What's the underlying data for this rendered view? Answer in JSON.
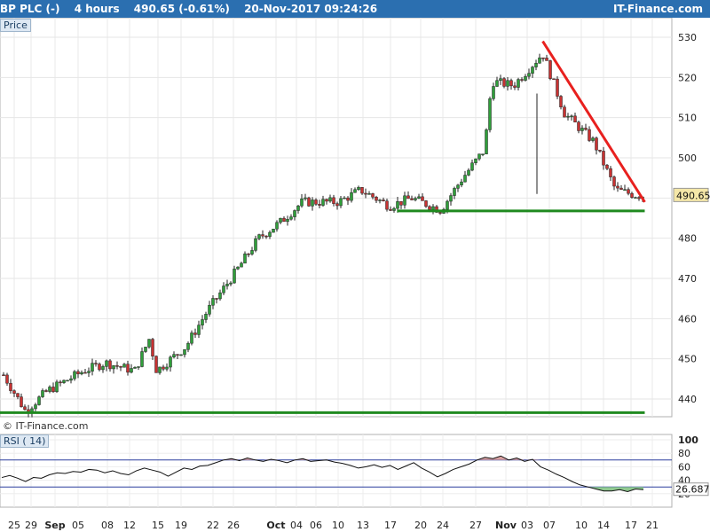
{
  "header": {
    "symbol": "BP PLC (-)",
    "timeframe": "4 hours",
    "quote": "490.65 (-0.61%)",
    "datetime": "20-Nov-2017 09:24:26",
    "brand": "IT-Finance.com"
  },
  "price_chip": "Price",
  "rsi_chip": "RSI ( 14)",
  "watermark": "© IT-Finance.com",
  "colors": {
    "header_bg": "#2b6fb0",
    "bull": "#2f9e3a",
    "bear": "#c83232",
    "resistance": "#e8201e",
    "support": "#1f8a1f",
    "rsi_band": "#2b3f9e",
    "rsi_over": "#d9a1a1",
    "rsi_under": "#8fc98f",
    "last_price_bg": "#f5e7a8"
  },
  "chart_data": [
    {
      "type": "candlestick",
      "ylim": [
        434,
        533
      ],
      "y_ticks": [
        440,
        450,
        460,
        470,
        480,
        490,
        500,
        510,
        520,
        530
      ],
      "last_price_label": "490.65",
      "x_tick_labels": [
        "25",
        "29",
        "Sep",
        "05",
        "08",
        "12",
        "15",
        "19",
        "22",
        "26",
        "Oct",
        "04",
        "06",
        "10",
        "13",
        "17",
        "20",
        "24",
        "27",
        "Nov",
        "03",
        "07",
        "10",
        "14",
        "17",
        "21"
      ],
      "key_points": [
        {
          "date": "2017-08-25",
          "price": 446
        },
        {
          "date": "2017-08-28",
          "price": 437
        },
        {
          "date": "2017-08-31",
          "price": 442
        },
        {
          "date": "2017-09-05",
          "price": 447
        },
        {
          "date": "2017-09-08",
          "price": 449
        },
        {
          "date": "2017-09-12",
          "price": 447
        },
        {
          "date": "2017-09-14",
          "price": 455
        },
        {
          "date": "2017-09-15",
          "price": 447
        },
        {
          "date": "2017-09-19",
          "price": 453
        },
        {
          "date": "2017-09-22",
          "price": 462
        },
        {
          "date": "2017-09-26",
          "price": 472
        },
        {
          "date": "2017-09-29",
          "price": 480
        },
        {
          "date": "2017-10-02",
          "price": 484
        },
        {
          "date": "2017-10-05",
          "price": 489
        },
        {
          "date": "2017-10-10",
          "price": 489
        },
        {
          "date": "2017-10-13",
          "price": 492
        },
        {
          "date": "2017-10-17",
          "price": 488
        },
        {
          "date": "2017-10-20",
          "price": 490
        },
        {
          "date": "2017-10-24",
          "price": 487
        },
        {
          "date": "2017-10-27",
          "price": 495
        },
        {
          "date": "2017-10-30",
          "price": 502
        },
        {
          "date": "2017-10-31",
          "price": 519
        },
        {
          "date": "2017-11-03",
          "price": 518
        },
        {
          "date": "2017-11-07",
          "price": 526
        },
        {
          "date": "2017-11-10",
          "price": 511
        },
        {
          "date": "2017-11-14",
          "price": 504
        },
        {
          "date": "2017-11-17",
          "price": 492
        },
        {
          "date": "2017-11-20",
          "price": 490.65
        }
      ],
      "trendlines": [
        {
          "name": "resistance",
          "from": {
            "date": "2017-11-07",
            "price": 529
          },
          "to": {
            "date": "2017-11-21",
            "price": 489
          }
        },
        {
          "name": "support",
          "from": {
            "date": "2017-10-18",
            "price": 486.8
          },
          "to": {
            "date": "2017-11-21",
            "price": 486.8
          }
        },
        {
          "name": "support",
          "from": {
            "date": "2017-08-24",
            "price": 436.6
          },
          "to": {
            "date": "2017-11-21",
            "price": 436.6
          }
        }
      ],
      "grid": true
    },
    {
      "type": "line",
      "name": "RSI ( 14)",
      "ylim": [
        0,
        100
      ],
      "y_ticks": [
        20,
        40,
        60,
        80,
        100
      ],
      "bands": [
        70,
        30
      ],
      "last_value_label": "26.687",
      "values": [
        44,
        47,
        43,
        38,
        44,
        43,
        48,
        51,
        50,
        53,
        52,
        56,
        55,
        51,
        54,
        50,
        48,
        54,
        58,
        55,
        52,
        46,
        52,
        58,
        56,
        61,
        62,
        66,
        70,
        72,
        69,
        73,
        70,
        68,
        71,
        69,
        66,
        70,
        72,
        68,
        69,
        70,
        67,
        65,
        62,
        58,
        60,
        63,
        59,
        62,
        56,
        61,
        66,
        58,
        52,
        45,
        50,
        56,
        60,
        64,
        70,
        74,
        72,
        76,
        70,
        73,
        68,
        71,
        60,
        55,
        49,
        44,
        38,
        33,
        30,
        27,
        24,
        24,
        26,
        23,
        27,
        26
      ]
    }
  ]
}
